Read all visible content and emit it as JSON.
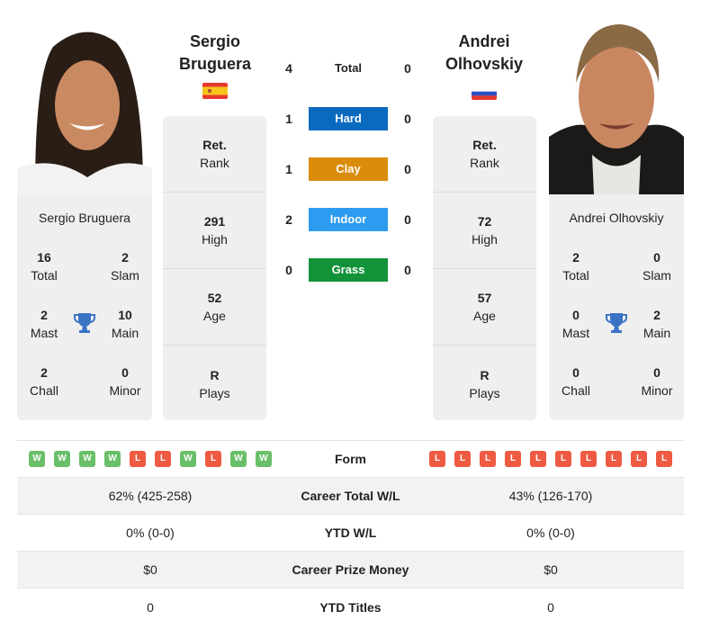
{
  "player_left": {
    "name_line1": "Sergio",
    "name_line2": "Bruguera",
    "full_name": "Sergio Bruguera",
    "country_flag": "spain-flag",
    "rank_value": "Ret.",
    "rank_label": "Rank",
    "high_value": "291",
    "high_label": "High",
    "age_value": "52",
    "age_label": "Age",
    "plays_value": "R",
    "plays_label": "Plays",
    "titles": {
      "total": {
        "value": "16",
        "label": "Total"
      },
      "slam": {
        "value": "2",
        "label": "Slam"
      },
      "mast": {
        "value": "2",
        "label": "Mast"
      },
      "main": {
        "value": "10",
        "label": "Main"
      },
      "chall": {
        "value": "2",
        "label": "Chall"
      },
      "minor": {
        "value": "0",
        "label": "Minor"
      }
    }
  },
  "player_right": {
    "name_line1": "Andrei",
    "name_line2": "Olhovskiy",
    "full_name": "Andrei Olhovskiy",
    "country_flag": "russia-flag",
    "rank_value": "Ret.",
    "rank_label": "Rank",
    "high_value": "72",
    "high_label": "High",
    "age_value": "57",
    "age_label": "Age",
    "plays_value": "R",
    "plays_label": "Plays",
    "titles": {
      "total": {
        "value": "2",
        "label": "Total"
      },
      "slam": {
        "value": "0",
        "label": "Slam"
      },
      "mast": {
        "value": "0",
        "label": "Mast"
      },
      "main": {
        "value": "2",
        "label": "Main"
      },
      "chall": {
        "value": "0",
        "label": "Chall"
      },
      "minor": {
        "value": "0",
        "label": "Minor"
      }
    }
  },
  "h2h": [
    {
      "label": "Total",
      "left": "4",
      "right": "0",
      "color": null
    },
    {
      "label": "Hard",
      "left": "1",
      "right": "0",
      "color": "#0a6abf"
    },
    {
      "label": "Clay",
      "left": "1",
      "right": "0",
      "color": "#db8c0a"
    },
    {
      "label": "Indoor",
      "left": "2",
      "right": "0",
      "color": "#2d9bf0"
    },
    {
      "label": "Grass",
      "left": "0",
      "right": "0",
      "color": "#129239"
    }
  ],
  "form": {
    "label": "Form",
    "left": [
      "W",
      "W",
      "W",
      "W",
      "L",
      "L",
      "W",
      "L",
      "W",
      "W"
    ],
    "right": [
      "L",
      "L",
      "L",
      "L",
      "L",
      "L",
      "L",
      "L",
      "L",
      "L"
    ]
  },
  "rows": [
    {
      "label": "Career Total W/L",
      "left": "62% (425-258)",
      "right": "43% (126-170)"
    },
    {
      "label": "YTD W/L",
      "left": "0% (0-0)",
      "right": "0% (0-0)"
    },
    {
      "label": "Career Prize Money",
      "left": "$0",
      "right": "$0"
    },
    {
      "label": "YTD Titles",
      "left": "0",
      "right": "0"
    }
  ]
}
